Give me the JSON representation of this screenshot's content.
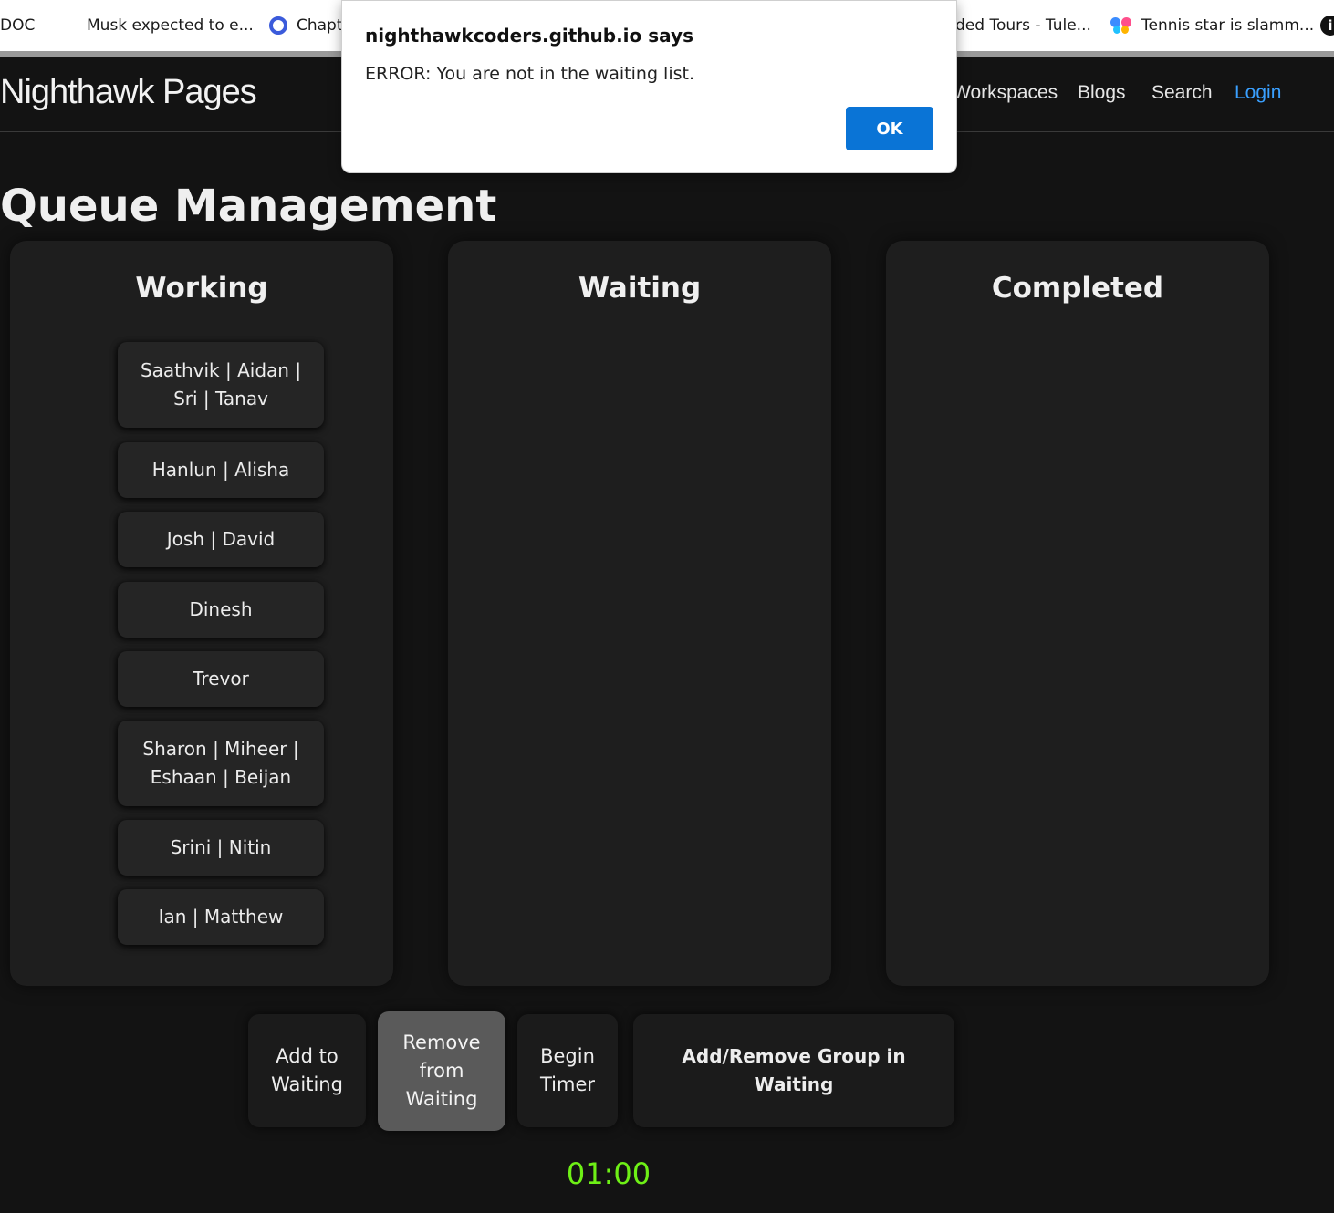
{
  "bookmarks": [
    {
      "label": "DOC",
      "icon": "none"
    },
    {
      "label": "Musk expected to e...",
      "icon": "microsoft-icon"
    },
    {
      "label": "Chapt",
      "icon": "q-icon"
    },
    {
      "label": "ded Tours - Tule...",
      "icon": "none"
    },
    {
      "label": "Tennis star is slamm...",
      "icon": "butterfly-icon"
    }
  ],
  "nav": {
    "brand": "Nighthawk Pages",
    "links": [
      "Workspaces",
      "Blogs",
      "Search",
      "Login"
    ]
  },
  "page": {
    "title": "Queue Management"
  },
  "columns": {
    "working": {
      "title": "Working",
      "groups": [
        "Saathvik | Aidan | Sri | Tanav",
        "Hanlun | Alisha",
        "Josh | David",
        "Dinesh",
        "Trevor",
        "Sharon | Miheer | Eshaan | Beijan",
        "Srini | Nitin",
        "Ian | Matthew"
      ]
    },
    "waiting": {
      "title": "Waiting",
      "groups": []
    },
    "completed": {
      "title": "Completed",
      "groups": []
    }
  },
  "controls": {
    "add_waiting": "Add to Waiting",
    "remove_waiting": "Remove from Waiting",
    "begin_timer": "Begin Timer",
    "add_remove_group": "Add/Remove Group in Waiting"
  },
  "timer": {
    "value": "01:00",
    "color": "#6ef016"
  },
  "alert": {
    "title": "nighthawkcoders.github.io says",
    "message": "ERROR: You are not in the waiting list.",
    "ok_label": "OK"
  },
  "colors": {
    "accent_link": "#3aa0ff",
    "ok_button": "#0a74d6",
    "background": "#131313"
  }
}
